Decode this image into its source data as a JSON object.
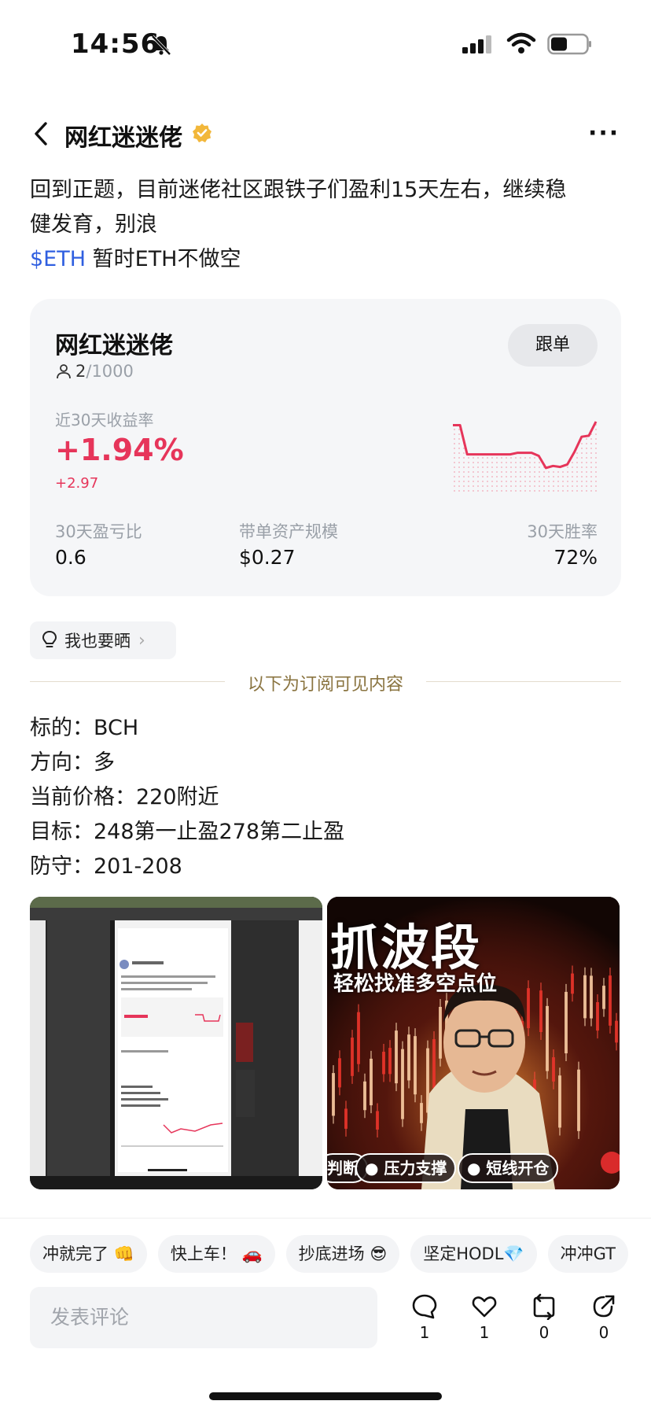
{
  "status_bar": {
    "time": "14:56"
  },
  "nav": {
    "title": "网红迷迷佬",
    "more": "···"
  },
  "post": {
    "line1": "回到正题，目前迷佬社区跟铁子们盈利15天左右，继续稳",
    "line2": "健发育，别浪",
    "tag": "$ETH",
    "line3_rest": " 暂时ETH不做空"
  },
  "card": {
    "name": "网红迷迷佬",
    "follow_label": "跟单",
    "followers_current": "2",
    "followers_max": "/1000",
    "roi_label": "近30天收益率",
    "roi_value": "+1.94%",
    "roi_sub": "+2.97",
    "sparkline_values": [
      0.93,
      0.93,
      0.35,
      0.35,
      0.35,
      0.35,
      0.35,
      0.35,
      0.35,
      0.38,
      0.38,
      0.38,
      0.32,
      0.08,
      0.12,
      0.1,
      0.15,
      0.4,
      0.7,
      0.72,
      1.0
    ],
    "stats": [
      {
        "label": "30天盈亏比",
        "value": "0.6"
      },
      {
        "label": "带单资产规模",
        "value": "$0.27"
      },
      {
        "label": "30天胜率",
        "value": "72%"
      }
    ],
    "accent_color": "#e6355a"
  },
  "share": {
    "label": "我也要晒"
  },
  "divider": {
    "label": "以下为订阅可见内容"
  },
  "subscriber": {
    "lines": [
      "标的：BCH",
      "方向：多",
      "当前价格：220附近",
      "目标：248第一止盈278第二止盈",
      "防守：201-208"
    ]
  },
  "images": {
    "promo_title": "抓波段",
    "promo_subtitle": "轻松找准多空点位",
    "promo_pills": [
      "判断",
      "● 压力支撑",
      "● 短线开仓"
    ]
  },
  "quick_replies": [
    "冲就完了 👊",
    "快上车！ 🚗",
    "抄底进场 😎",
    "坚定HODL💎",
    "冲冲GT"
  ],
  "comment": {
    "placeholder": "发表评论"
  },
  "actions": [
    {
      "icon": "comment-icon",
      "count": "1"
    },
    {
      "icon": "like-icon",
      "count": "1"
    },
    {
      "icon": "repost-icon",
      "count": "0"
    },
    {
      "icon": "share-icon",
      "count": "0"
    }
  ]
}
